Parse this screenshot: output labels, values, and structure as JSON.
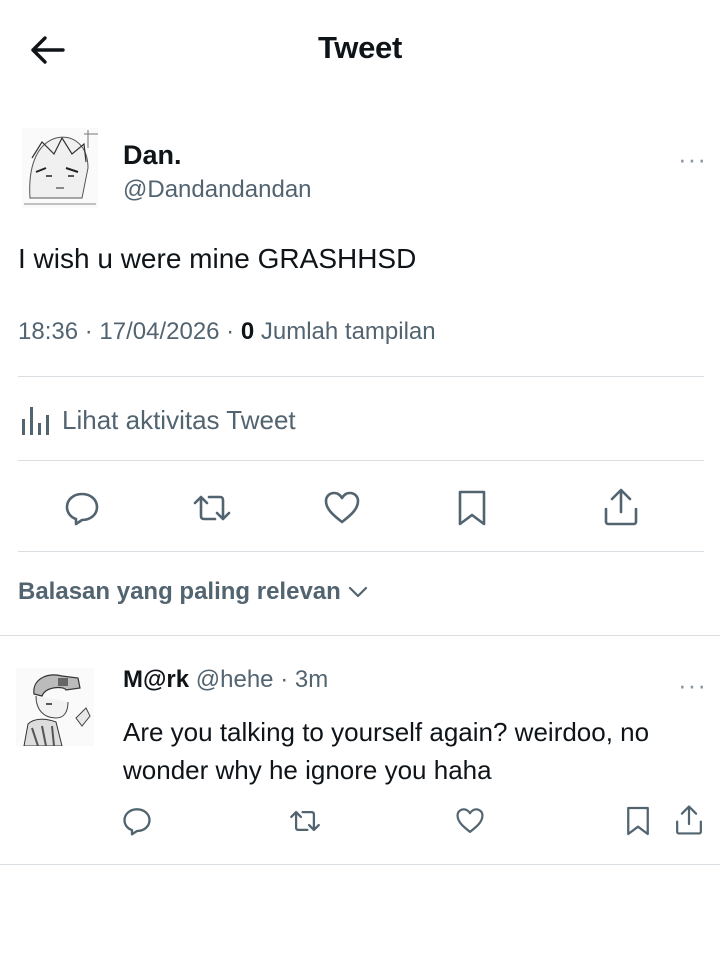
{
  "header": {
    "title": "Tweet",
    "back_icon": "back-arrow-icon"
  },
  "tweet": {
    "author_name": "Dan.",
    "author_handle": "@Dandandandan",
    "more_label": "···",
    "text": "I wish u were mine GRASHHSD",
    "time": "18:36",
    "date": "17/04/2026",
    "view_count": "0",
    "views_label": "Jumlah tampilan",
    "activity_label": "Lihat aktivitas Tweet",
    "actions": [
      "reply-icon",
      "retweet-icon",
      "like-icon",
      "bookmark-icon",
      "share-icon"
    ]
  },
  "replies_sort": {
    "label": "Balasan yang paling relevan"
  },
  "reply": {
    "name": "M@rk",
    "handle": "@hehe",
    "separator": "·",
    "time": "3m",
    "more_label": "···",
    "text": "Are you talking to yourself again? weirdoo, no wonder why he ignore you haha"
  },
  "colors": {
    "text": "#0f1419",
    "secondary": "#536471",
    "divider": "#d9dee2"
  }
}
